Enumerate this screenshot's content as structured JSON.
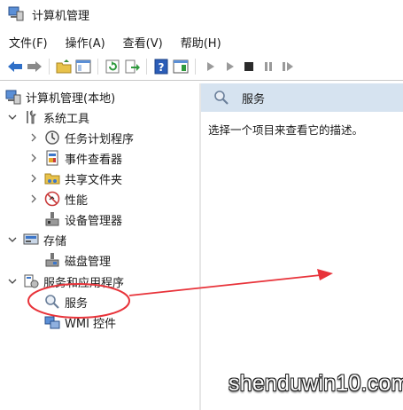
{
  "window": {
    "title": "计算机管理"
  },
  "menu": [
    {
      "label": "文件(F)"
    },
    {
      "label": "操作(A)"
    },
    {
      "label": "查看(V)"
    },
    {
      "label": "帮助(H)"
    }
  ],
  "toolbar": {
    "buttons": [
      "back-arrow-icon",
      "forward-arrow-icon",
      "up-folder-icon",
      "show-hide-tree-icon",
      "refresh-icon",
      "export-list-icon",
      "help-icon",
      "properties-icon",
      "play-icon",
      "play-alt-icon",
      "stop-icon",
      "pause-icon",
      "restart-icon"
    ]
  },
  "tree": {
    "root": "计算机管理(本地)",
    "items": [
      {
        "label": "系统工具"
      },
      {
        "label": "任务计划程序"
      },
      {
        "label": "事件查看器"
      },
      {
        "label": "共享文件夹"
      },
      {
        "label": "性能"
      },
      {
        "label": "设备管理器"
      },
      {
        "label": "存储"
      },
      {
        "label": "磁盘管理"
      },
      {
        "label": "服务和应用程序"
      },
      {
        "label": "服务"
      },
      {
        "label": "WMI 控件"
      }
    ]
  },
  "right_pane": {
    "header": "服务",
    "description": "选择一个项目来查看它的描述。"
  },
  "watermark": "shenduwin10.com",
  "colors": {
    "header_bg": "#d6e3f0",
    "annotation_red": "#e8333a"
  }
}
